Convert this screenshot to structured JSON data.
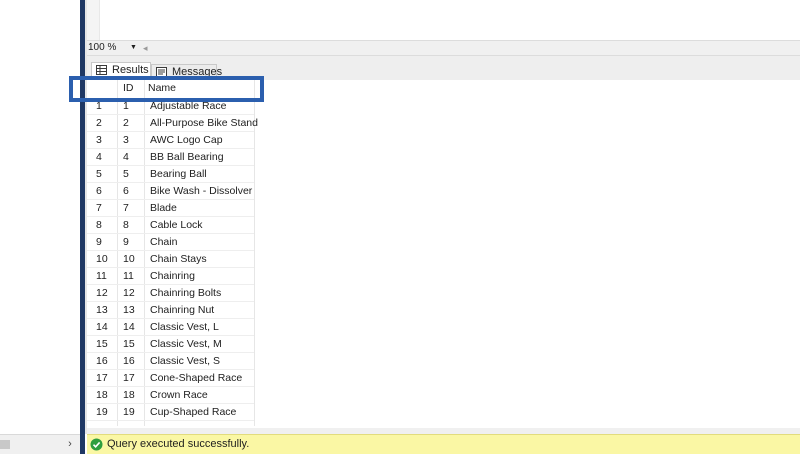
{
  "editor": {
    "zoom": "100 %"
  },
  "results": {
    "tabs": [
      {
        "label": "Results",
        "icon": "grid-icon"
      },
      {
        "label": "Messages",
        "icon": "messages-icon"
      }
    ],
    "columns": [
      "ID",
      "Name"
    ],
    "rows": [
      {
        "num": "1",
        "id": "1",
        "name": "Adjustable Race"
      },
      {
        "num": "2",
        "id": "2",
        "name": "All-Purpose Bike Stand"
      },
      {
        "num": "3",
        "id": "3",
        "name": "AWC Logo Cap"
      },
      {
        "num": "4",
        "id": "4",
        "name": "BB Ball Bearing"
      },
      {
        "num": "5",
        "id": "5",
        "name": "Bearing Ball"
      },
      {
        "num": "6",
        "id": "6",
        "name": "Bike Wash - Dissolver"
      },
      {
        "num": "7",
        "id": "7",
        "name": "Blade"
      },
      {
        "num": "8",
        "id": "8",
        "name": "Cable Lock"
      },
      {
        "num": "9",
        "id": "9",
        "name": "Chain"
      },
      {
        "num": "10",
        "id": "10",
        "name": "Chain Stays"
      },
      {
        "num": "11",
        "id": "11",
        "name": "Chainring"
      },
      {
        "num": "12",
        "id": "12",
        "name": "Chainring Bolts"
      },
      {
        "num": "13",
        "id": "13",
        "name": "Chainring Nut"
      },
      {
        "num": "14",
        "id": "14",
        "name": "Classic Vest, L"
      },
      {
        "num": "15",
        "id": "15",
        "name": "Classic Vest, M"
      },
      {
        "num": "16",
        "id": "16",
        "name": "Classic Vest, S"
      },
      {
        "num": "17",
        "id": "17",
        "name": "Cone-Shaped Race"
      },
      {
        "num": "18",
        "id": "18",
        "name": "Crown Race"
      },
      {
        "num": "19",
        "id": "19",
        "name": "Cup-Shaped Race"
      }
    ]
  },
  "status": {
    "text": "Query executed successfully.",
    "icon": "check-circle-icon",
    "color": "#faf7a4"
  },
  "colors": {
    "splitter": "#1f3864",
    "highlight": "#2b5fae",
    "success": "#2e9e3e"
  }
}
